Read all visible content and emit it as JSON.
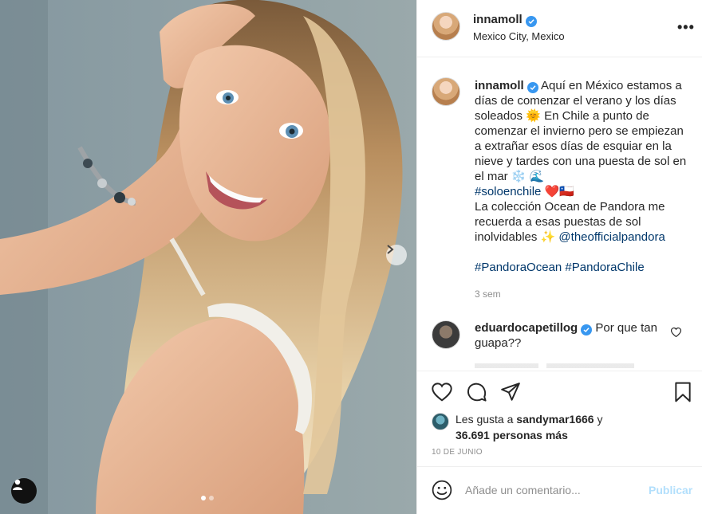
{
  "post": {
    "username": "innamoll",
    "location": "Mexico City, Mexico",
    "more_label": "•••",
    "caption": {
      "text1": " Aquí en México estamos a días de comenzar el verano y los días soleados ",
      "emoji_sun": "🌞",
      "text2": " En Chile a punto de comenzar el invierno pero se empiezan a extrañar esos días de esquiar en la nieve y tardes con una puesta de sol en el mar ",
      "emoji_snow_wave": "❄️ 🌊",
      "hashtag1": "#soloenchile",
      "emoji_heart_cl": "❤️🇨🇱",
      "text3": "La colección Ocean de Pandora me recuerda a esas puestas de sol inolvidables ",
      "emoji_sparkle": "✨",
      "mention": "@theofficialpandora",
      "hashtag2": "#PandoraOcean",
      "hashtag3": "#PandoraChile"
    },
    "caption_time": "3 sem",
    "comment": {
      "username": "eduardocapetillog",
      "text": "Por que tan guapa??"
    },
    "likes": {
      "prefix": "Les gusta a ",
      "user": "sandymar1666",
      "mid": " y",
      "count": "36.691 personas más"
    },
    "date": "10 DE JUNIO",
    "add_comment": {
      "placeholder": "Añade un comentario...",
      "publish_label": "Publicar"
    }
  },
  "carousel": {
    "slides": 2,
    "active": 0
  },
  "colors": {
    "verified": "#3897f0",
    "link": "#00376b",
    "publish_disabled": "#b2dffc",
    "muted": "#8e8e8e"
  },
  "icons": {
    "like": "heart-icon",
    "comment": "comment-icon",
    "share": "paper-plane-icon",
    "save": "bookmark-icon",
    "emoji": "smiley-icon",
    "more": "ellipsis-icon",
    "next": "chevron-right-icon",
    "tag": "user-tag-icon"
  }
}
